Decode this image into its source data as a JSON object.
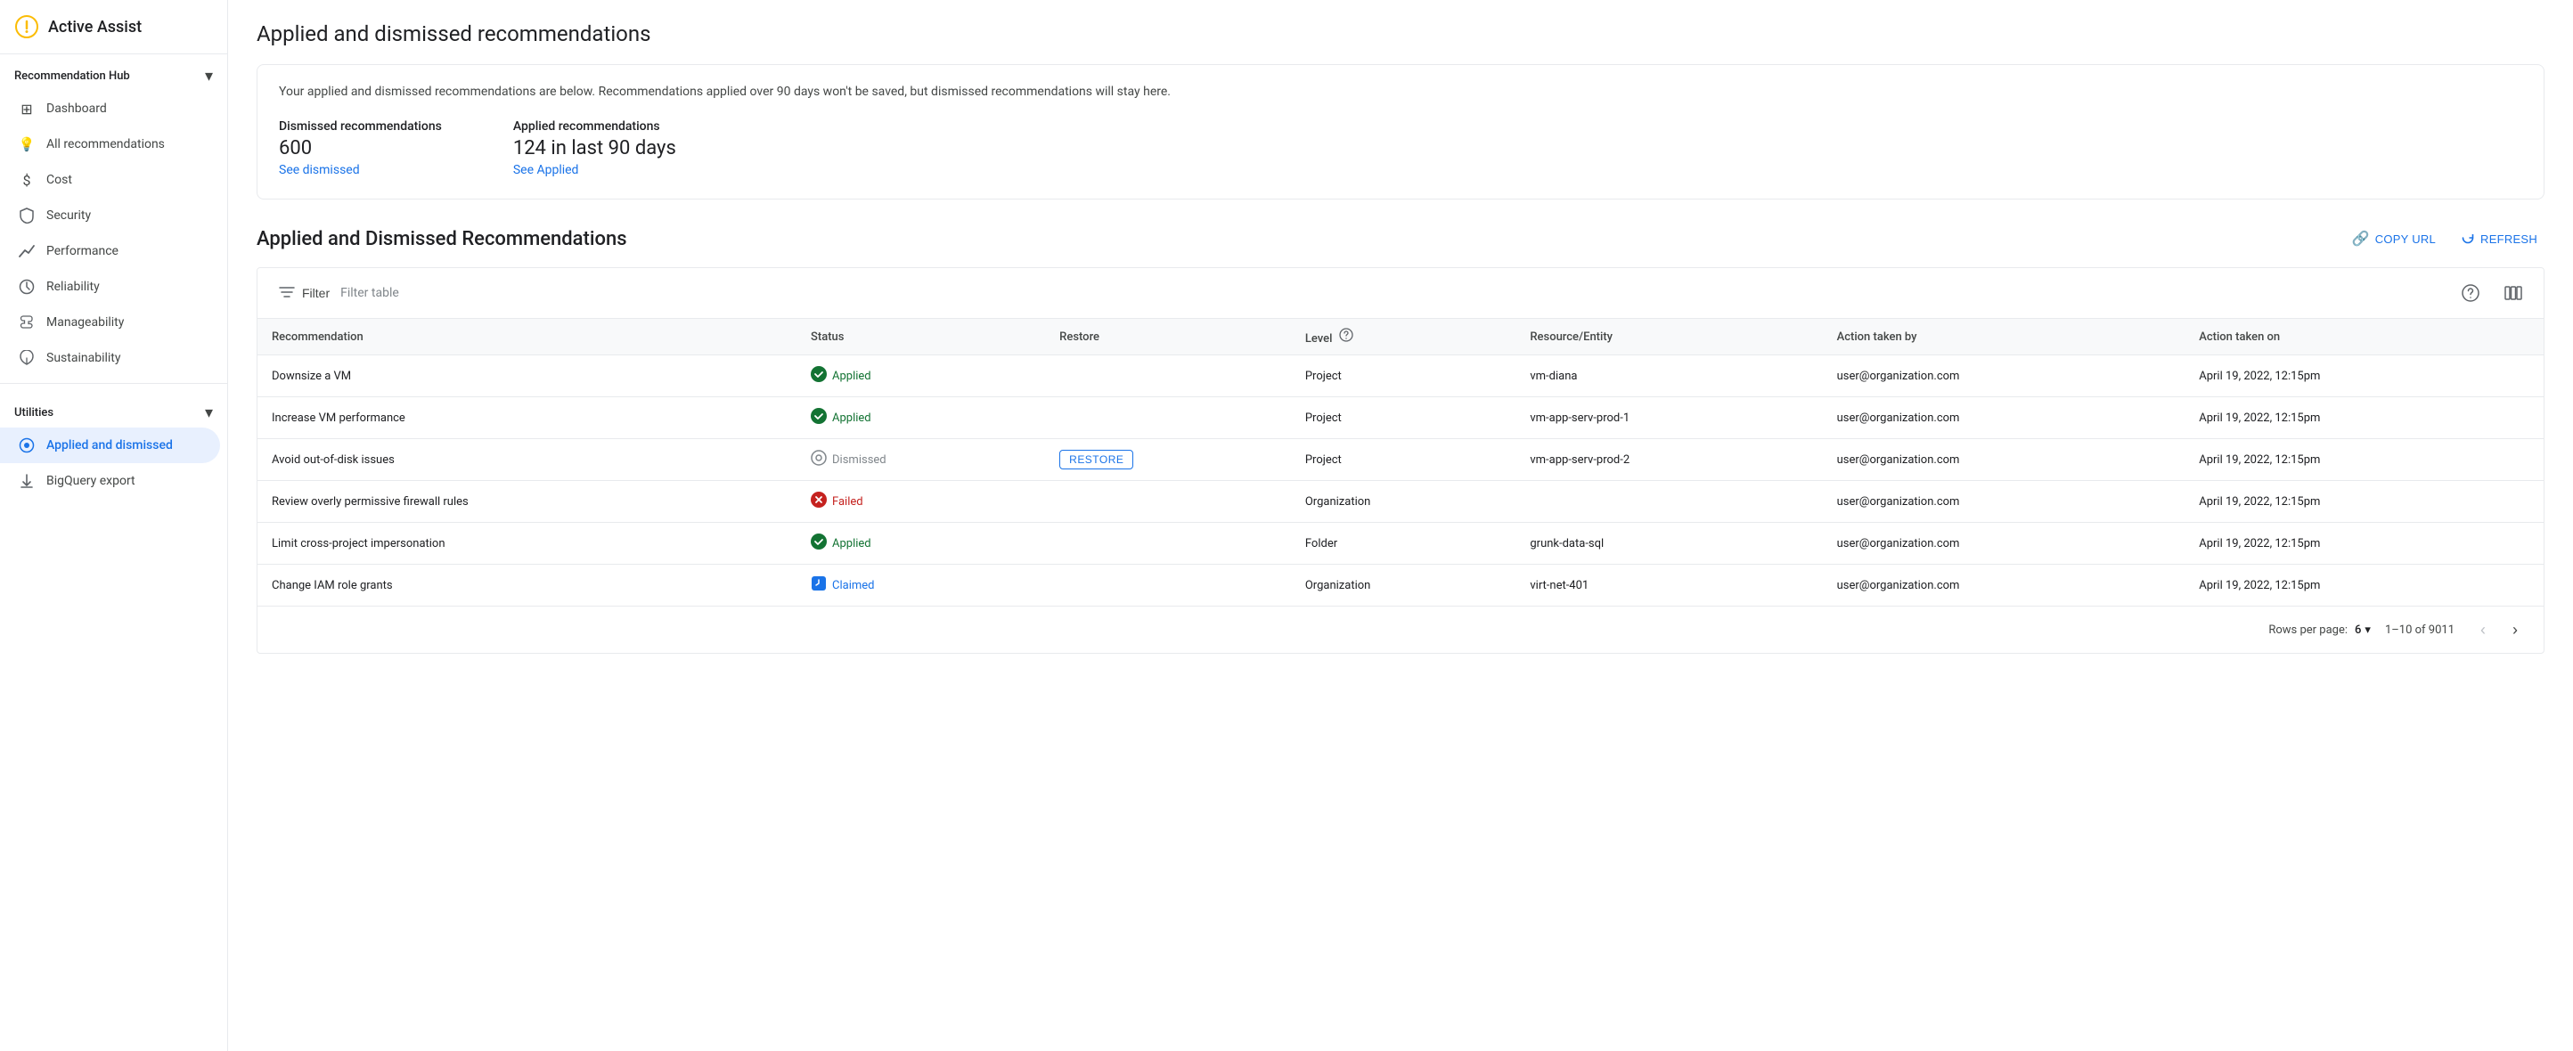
{
  "sidebar": {
    "app_title": "Active Assist",
    "recommendation_hub_label": "Recommendation Hub",
    "utilities_label": "Utilities",
    "items": [
      {
        "id": "dashboard",
        "label": "Dashboard",
        "icon": "⊞"
      },
      {
        "id": "all-recommendations",
        "label": "All recommendations",
        "icon": "💡"
      },
      {
        "id": "cost",
        "label": "Cost",
        "icon": "$"
      },
      {
        "id": "security",
        "label": "Security",
        "icon": "🔒"
      },
      {
        "id": "performance",
        "label": "Performance",
        "icon": "↗"
      },
      {
        "id": "reliability",
        "label": "Reliability",
        "icon": "⏱"
      },
      {
        "id": "manageability",
        "label": "Manageability",
        "icon": "🔧"
      },
      {
        "id": "sustainability",
        "label": "Sustainability",
        "icon": "🌿"
      }
    ],
    "utility_items": [
      {
        "id": "applied-and-dismissed",
        "label": "Applied and dismissed",
        "icon": "⊙",
        "active": true
      },
      {
        "id": "bigquery-export",
        "label": "BigQuery export",
        "icon": "↑"
      }
    ]
  },
  "page": {
    "title": "Applied and dismissed recommendations",
    "info_text": "Your applied and dismissed recommendations are below. Recommendations applied over 90 days won't be saved, but dismissed recommendations will stay here.",
    "dismissed_label": "Dismissed recommendations",
    "dismissed_count": "600",
    "see_dismissed_link": "See dismissed",
    "applied_label": "Applied recommendations",
    "applied_count": "124 in last 90 days",
    "see_applied_link": "See Applied",
    "section_title": "Applied and Dismissed Recommendations",
    "copy_url_label": "COPY URL",
    "refresh_label": "REFRESH",
    "filter_label": "Filter",
    "filter_placeholder": "Filter table",
    "columns": [
      {
        "id": "recommendation",
        "label": "Recommendation"
      },
      {
        "id": "status",
        "label": "Status"
      },
      {
        "id": "restore",
        "label": "Restore"
      },
      {
        "id": "level",
        "label": "Level",
        "has_help": true
      },
      {
        "id": "resource",
        "label": "Resource/Entity"
      },
      {
        "id": "action_by",
        "label": "Action taken by"
      },
      {
        "id": "action_on",
        "label": "Action taken on"
      }
    ],
    "rows": [
      {
        "recommendation": "Downsize a VM",
        "status": "Applied",
        "status_type": "applied",
        "restore": "",
        "level": "Project",
        "resource": "vm-diana",
        "action_by": "user@organization.com",
        "action_on": "April 19, 2022, 12:15pm"
      },
      {
        "recommendation": "Increase VM performance",
        "status": "Applied",
        "status_type": "applied",
        "restore": "",
        "level": "Project",
        "resource": "vm-app-serv-prod-1",
        "action_by": "user@organization.com",
        "action_on": "April 19, 2022, 12:15pm"
      },
      {
        "recommendation": "Avoid out-of-disk issues",
        "status": "Dismissed",
        "status_type": "dismissed",
        "restore": "RESTORE",
        "level": "Project",
        "resource": "vm-app-serv-prod-2",
        "action_by": "user@organization.com",
        "action_on": "April 19, 2022, 12:15pm"
      },
      {
        "recommendation": "Review overly permissive firewall rules",
        "status": "Failed",
        "status_type": "failed",
        "restore": "",
        "level": "Organization",
        "resource": "",
        "action_by": "user@organization.com",
        "action_on": "April 19, 2022, 12:15pm"
      },
      {
        "recommendation": "Limit cross-project impersonation",
        "status": "Applied",
        "status_type": "applied",
        "restore": "",
        "level": "Folder",
        "resource": "grunk-data-sql",
        "action_by": "user@organization.com",
        "action_on": "April 19, 2022, 12:15pm"
      },
      {
        "recommendation": "Change IAM role grants",
        "status": "Claimed",
        "status_type": "claimed",
        "restore": "",
        "level": "Organization",
        "resource": "virt-net-401",
        "action_by": "user@organization.com",
        "action_on": "April 19, 2022, 12:15pm"
      }
    ],
    "pagination": {
      "rows_per_page_label": "Rows per page:",
      "rows_per_page_value": "6",
      "range_label": "1–10 of 9011"
    }
  }
}
